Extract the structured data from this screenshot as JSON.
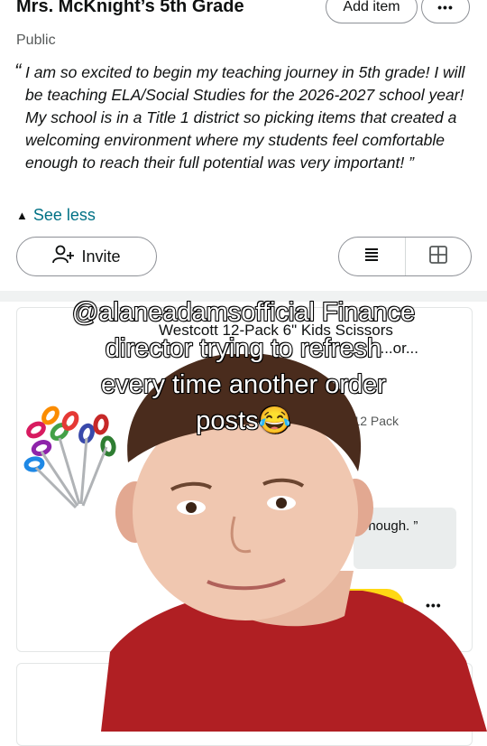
{
  "header": {
    "title": "Mrs. McKnight’s 5th Grade",
    "add_item_label": "Add item",
    "more_label": "•••"
  },
  "list": {
    "visibility": "Public",
    "description_open_quote": "“",
    "description": "I am so excited to begin my teaching journey in 5th grade! I will be teaching ELA/Social Studies for the 2026-2027 school year! My school is in a Title 1 district so picking items that created a welcoming environment where my students feel comfortable enough to reach their full potential was very important! ”",
    "see_less_label": "See less",
    "invite_label": "Invite"
  },
  "item": {
    "title_line1": "Westcott 12-Pack 6\" Kids Scissors",
    "title_line2": "...or...",
    "subtitle": "s - 12 Pack",
    "comment_fragment": "enough. ”",
    "more_label": "•••"
  },
  "overlay": {
    "caption_line1": "@alaneadamsofficial  Finance",
    "caption_line2": "director trying to refresh",
    "caption_line3": "every time another order",
    "caption_line4": "posts😂"
  },
  "icons": {
    "invite": "add-person-icon",
    "list_view": "list-view-icon",
    "grid_view": "grid-view-icon",
    "chevron": "chevron-up-icon"
  },
  "colors": {
    "link": "#007185",
    "buy_button": "#ffd814",
    "shirt": "#b01f23"
  }
}
